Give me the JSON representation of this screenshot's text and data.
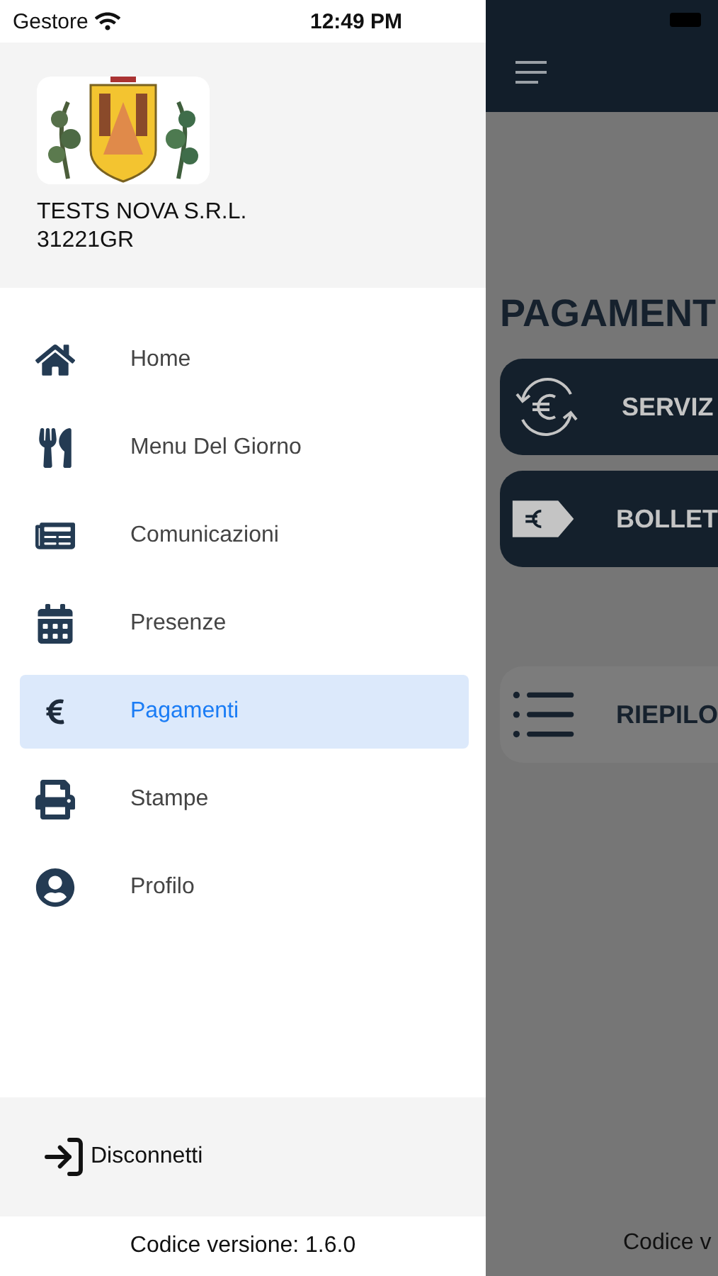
{
  "status_bar": {
    "carrier": "Gestore",
    "time": "12:49 PM"
  },
  "drawer": {
    "company": "TESTS NOVA S.R.L.",
    "code": "31221GR",
    "items": [
      {
        "label": "Home",
        "kind": "home",
        "selected": false
      },
      {
        "label": "Menu Del Giorno",
        "kind": "cutlery",
        "selected": false
      },
      {
        "label": "Comunicazioni",
        "kind": "document",
        "selected": false
      },
      {
        "label": "Presenze",
        "kind": "calendar",
        "selected": false
      },
      {
        "label": "Pagamenti",
        "kind": "euro",
        "selected": true
      },
      {
        "label": "Stampe",
        "kind": "printer",
        "selected": false
      },
      {
        "label": "Profilo",
        "kind": "user",
        "selected": false
      }
    ],
    "logout": "Disconnetti",
    "version": "Codice versione: 1.6.0"
  },
  "background_page": {
    "title": "PAGAMENT",
    "cards": [
      {
        "label": "SERVIZ",
        "kind": "services"
      },
      {
        "label": "BOLLET",
        "kind": "bill"
      },
      {
        "label": "RIEPILO",
        "kind": "summary"
      }
    ],
    "version": "Codice v"
  }
}
